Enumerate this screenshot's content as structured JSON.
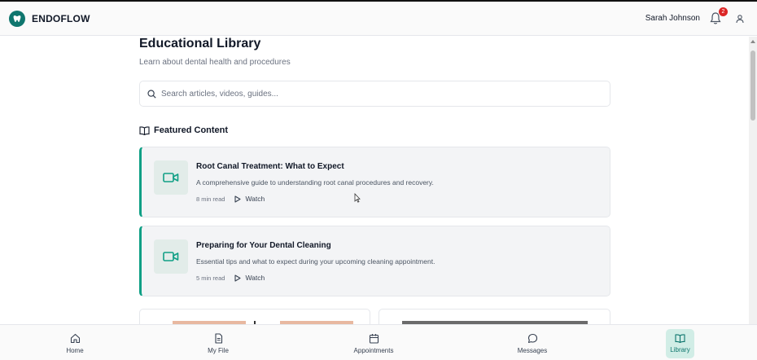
{
  "app": {
    "brand": "ENDOFLOW"
  },
  "header": {
    "user_name": "Sarah Johnson",
    "notification_count": "2"
  },
  "page": {
    "title": "Educational Library",
    "subtitle": "Learn about dental health and procedures",
    "search_placeholder": "Search articles, videos, guides..."
  },
  "featured": {
    "heading": "Featured Content",
    "items": [
      {
        "title": "Root Canal Treatment: What to Expect",
        "description": "A comprehensive guide to understanding root canal procedures and recovery.",
        "read_time": "8 min read",
        "action": "Watch",
        "icon": "video-icon"
      },
      {
        "title": "Preparing for Your Dental Cleaning",
        "description": "Essential tips and what to expect during your upcoming cleaning appointment.",
        "read_time": "5 min read",
        "action": "Watch",
        "icon": "video-icon"
      }
    ]
  },
  "nav": {
    "items": [
      {
        "label": "Home",
        "icon": "home-icon"
      },
      {
        "label": "My File",
        "icon": "file-icon"
      },
      {
        "label": "Appointments",
        "icon": "calendar-icon"
      },
      {
        "label": "Messages",
        "icon": "message-icon"
      },
      {
        "label": "Library",
        "icon": "book-icon",
        "active": true
      }
    ]
  },
  "colors": {
    "accent": "#0f9f85",
    "brand": "#0f766e",
    "badge": "#dc2626"
  }
}
